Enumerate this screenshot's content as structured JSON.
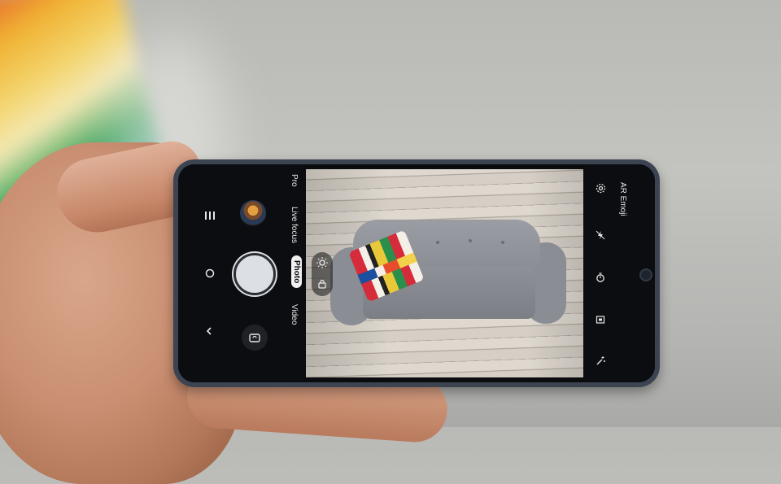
{
  "camera_modes": {
    "pro": "Pro",
    "live_focus": "Live focus",
    "photo": "Photo",
    "video": "Video",
    "ar_emoji": "AR Emoji"
  },
  "icons": {
    "menu": "hamburger-icon",
    "circle": "circle-icon",
    "chevron": "chevron-up-icon",
    "flip": "camera-flip-icon",
    "settings": "gear-icon",
    "flash": "flash-off-icon",
    "timer": "timer-icon",
    "ratio": "aspect-ratio-icon",
    "effects": "sparkle-icon",
    "focus_sun": "brightness-icon",
    "focus_lock": "lock-icon"
  },
  "colors": {
    "phone_body": "#3c4452",
    "screen_bg": "#0b0c0e",
    "active_mode_bg": "#f1f1f1"
  }
}
